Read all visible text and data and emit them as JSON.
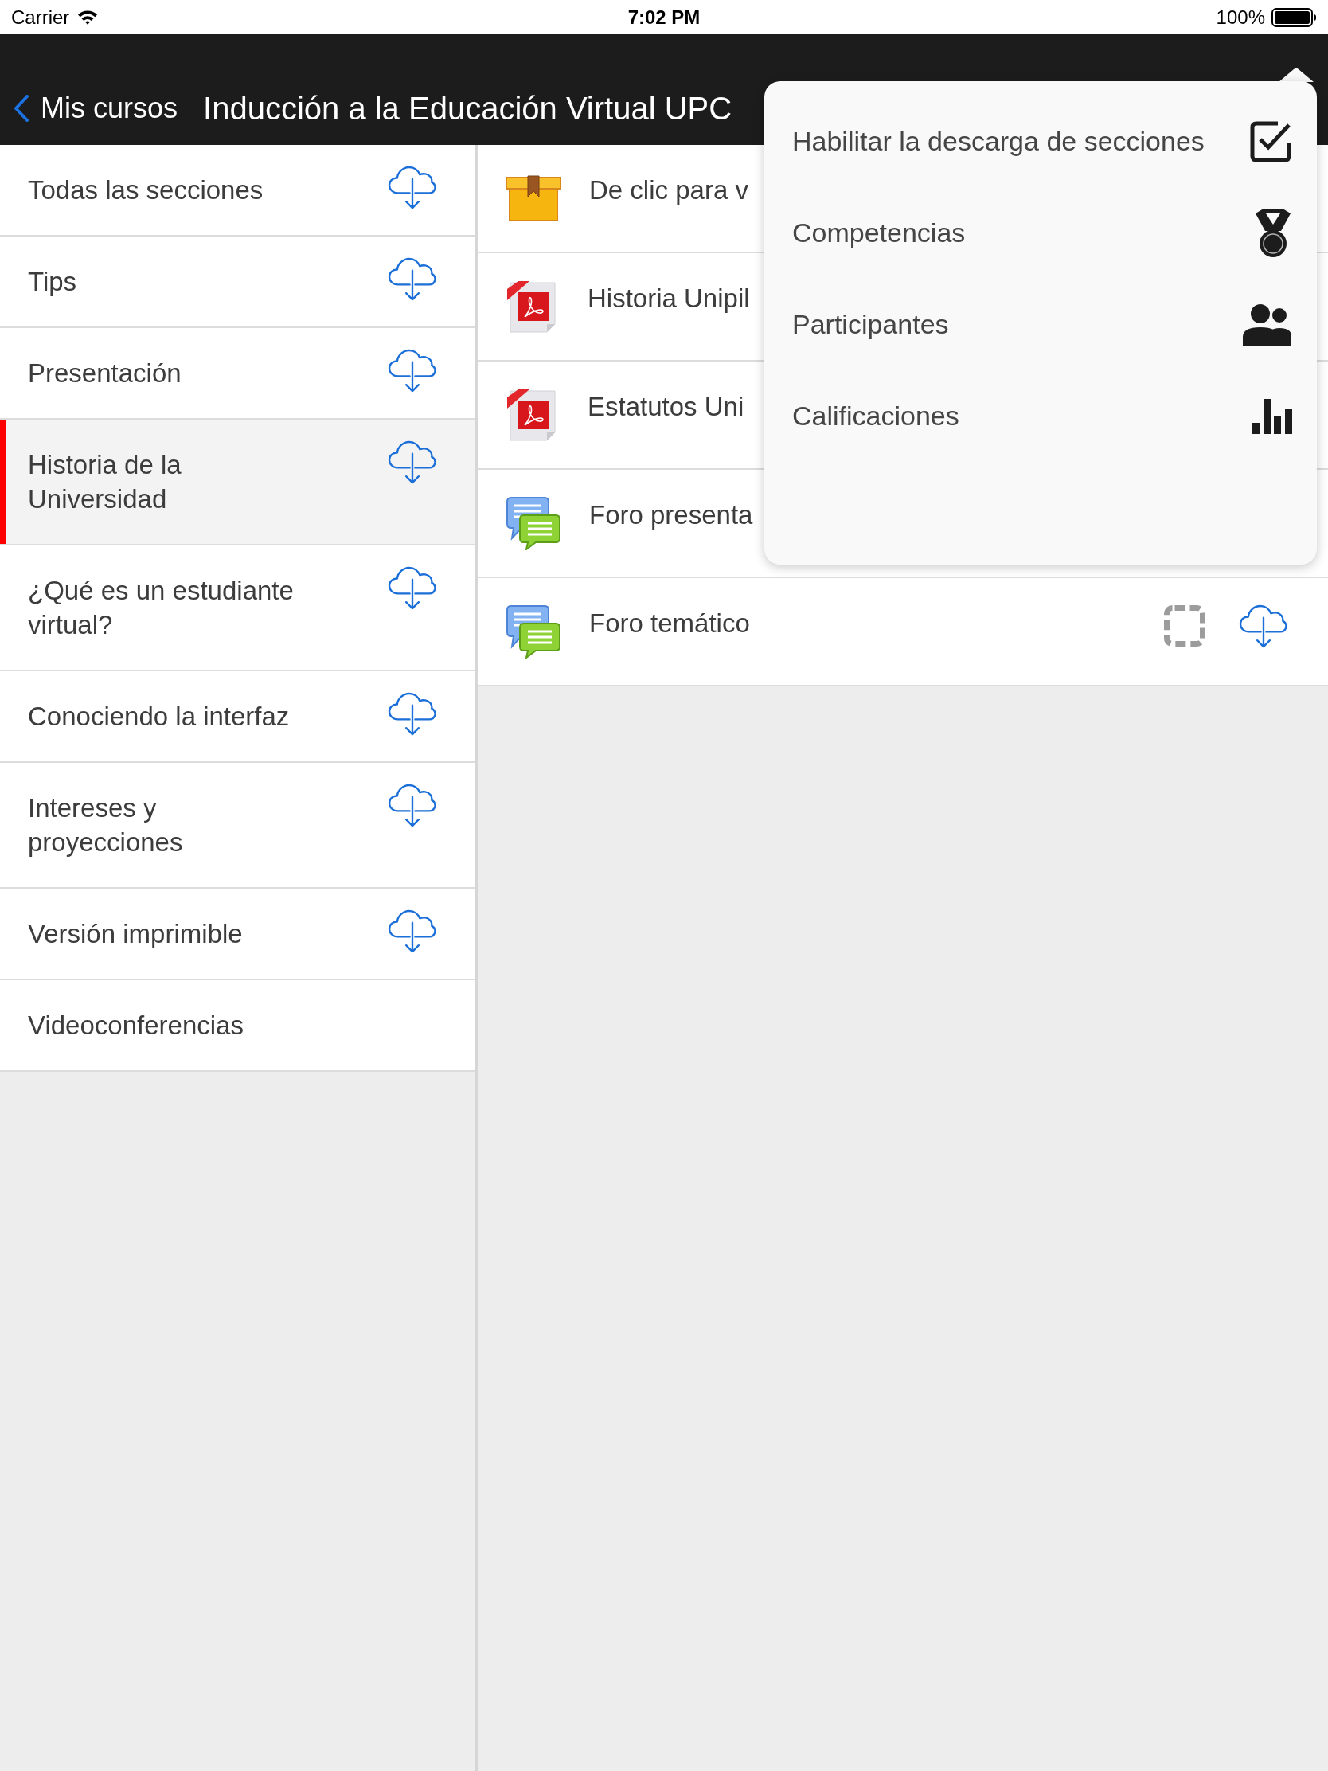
{
  "status_bar": {
    "carrier": "Carrier",
    "time": "7:02 PM",
    "battery": "100%"
  },
  "nav_bar": {
    "back_label": "Mis cursos",
    "title": "Inducción a la Educación Virtual UPC"
  },
  "sections": [
    {
      "label": "Todas las secciones",
      "selected": false,
      "download": true
    },
    {
      "label": "Tips",
      "selected": false,
      "download": true
    },
    {
      "label": "Presentación",
      "selected": false,
      "download": true
    },
    {
      "label": "Historia de la Universidad",
      "selected": true,
      "download": true
    },
    {
      "label": "¿Qué es un estudiante virtual?",
      "selected": false,
      "download": true
    },
    {
      "label": "Conociendo la interfaz",
      "selected": false,
      "download": true
    },
    {
      "label": "Intereses y proyecciones",
      "selected": false,
      "download": true
    },
    {
      "label": "Versión imprimible",
      "selected": false,
      "download": true
    },
    {
      "label": "Videoconferencias",
      "selected": false,
      "download": false
    }
  ],
  "modules": [
    {
      "kind": "package",
      "name": "De clic para v"
    },
    {
      "kind": "pdf",
      "name": "Historia Unipil"
    },
    {
      "kind": "pdf",
      "name": "Estatutos Uni"
    },
    {
      "kind": "forum",
      "name": "Foro presenta"
    },
    {
      "kind": "forum",
      "name": "Foro temático",
      "completed": false,
      "download": true
    }
  ],
  "menu": {
    "items": [
      {
        "kind": "checkbox",
        "label": "Habilitar la descarga de secciones",
        "checked": true
      },
      {
        "kind": "link",
        "label": "Competencias"
      },
      {
        "kind": "link",
        "label": "Participantes"
      },
      {
        "kind": "link",
        "label": "Calificaciones"
      }
    ]
  }
}
